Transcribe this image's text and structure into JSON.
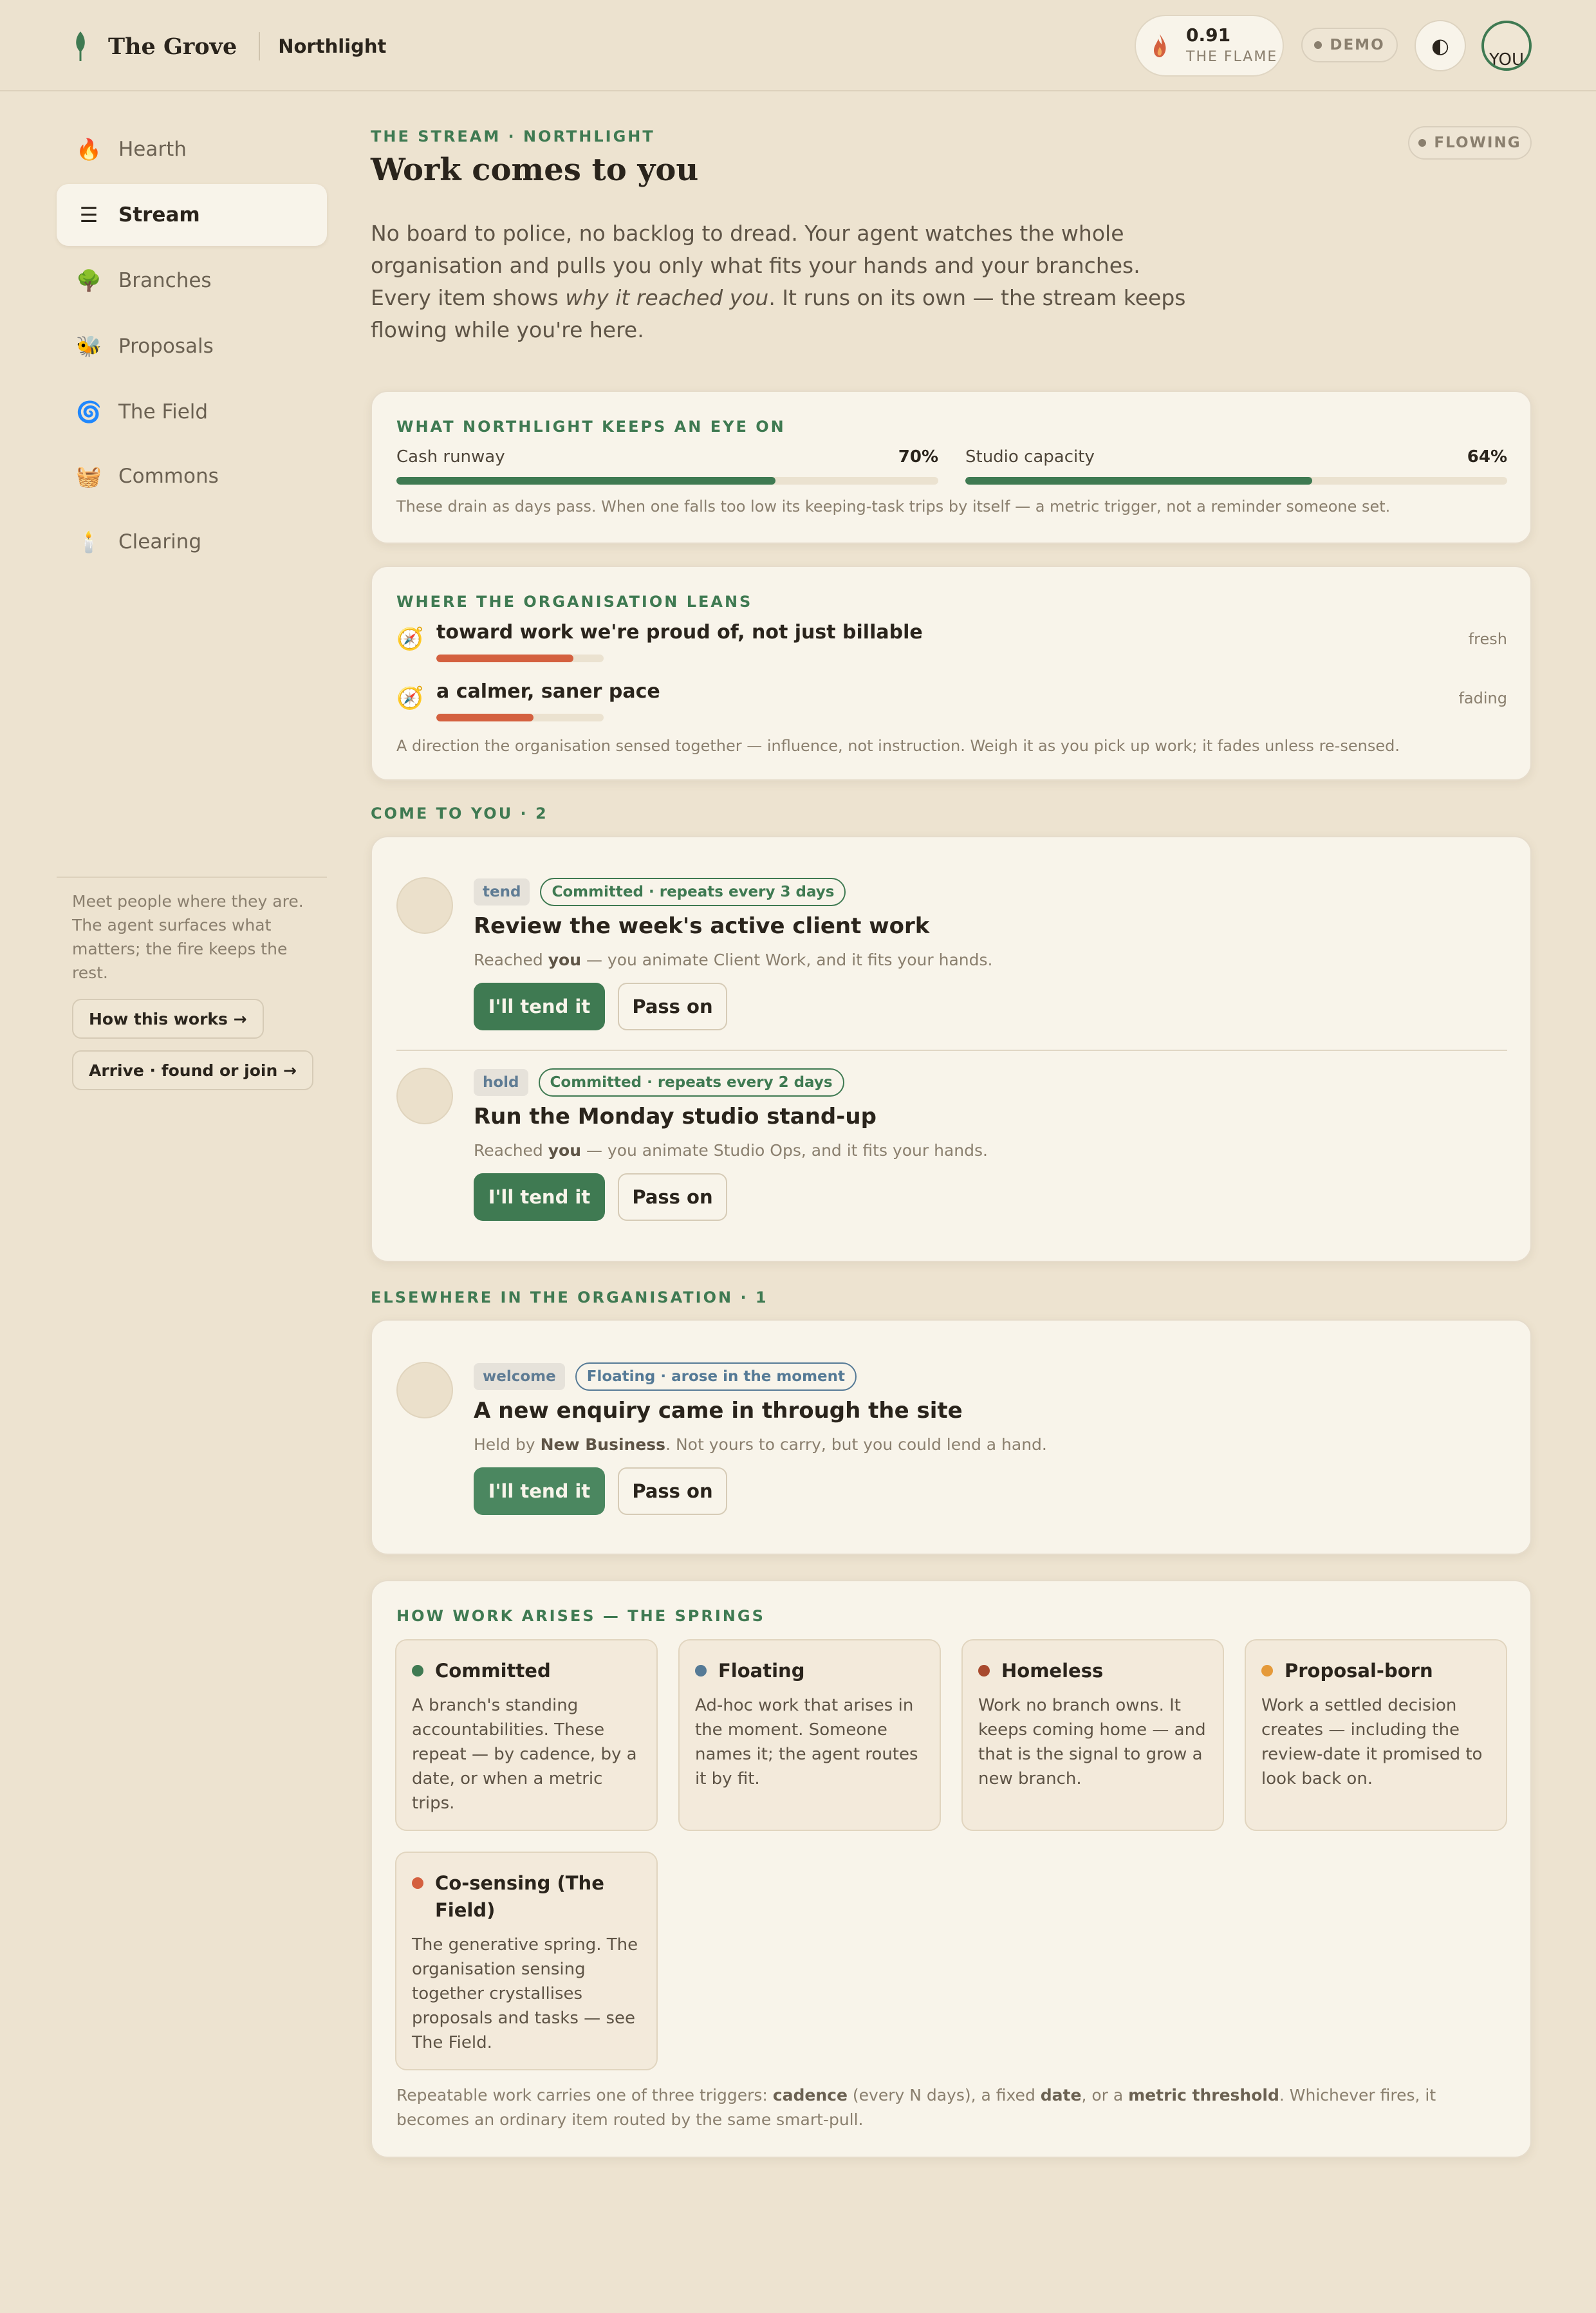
{
  "topbar": {
    "brand": "The Grove",
    "org": "Northlight",
    "flame_value": "0.91",
    "flame_label": "THE FLAME",
    "demo_label": "DEMO",
    "theme_icon": "◐",
    "avatar_alt": "YOU"
  },
  "sidebar": {
    "items": [
      {
        "icon": "🔥",
        "label": "Hearth"
      },
      {
        "icon": "☰",
        "label": "Stream"
      },
      {
        "icon": "🌳",
        "label": "Branches"
      },
      {
        "icon": "🐝",
        "label": "Proposals"
      },
      {
        "icon": "🌀",
        "label": "The Field"
      },
      {
        "icon": "🧺",
        "label": "Commons"
      },
      {
        "icon": "🕯️",
        "label": "Clearing"
      }
    ],
    "active": "Stream",
    "note": "Meet people where they are. The agent surfaces what matters; the fire keeps the rest.",
    "how_button": "How this works →",
    "arrive_button": "Arrive · found or join →"
  },
  "header": {
    "eyebrow": "THE STREAM · NORTHLIGHT",
    "title": "Work comes to you",
    "status": "FLOWING",
    "intro_a": "No board to police, no backlog to dread. Your agent watches the whole organisation and pulls you only what fits your hands and your branches. Every item shows ",
    "intro_em": "why it reached you",
    "intro_b": ". It runs on its own — the stream keeps flowing while you're here."
  },
  "watch": {
    "eyebrow": "WHAT NORTHLIGHT KEEPS AN EYE ON",
    "metrics": [
      {
        "label": "Cash runway",
        "value": "70%",
        "fraction": 0.7
      },
      {
        "label": "Studio capacity",
        "value": "64%",
        "fraction": 0.64
      }
    ],
    "foot": "These drain as days pass. When one falls too low its keeping-task trips by itself — a metric trigger, not a reminder someone set."
  },
  "leans": {
    "eyebrow": "WHERE THE ORGANISATION LEANS",
    "items": [
      {
        "icon": "🧭",
        "text": "toward work we're proud of, not just billable",
        "strength": 0.82,
        "state": "fresh"
      },
      {
        "icon": "🧭",
        "text": "a calmer, saner pace",
        "strength": 0.58,
        "state": "fading"
      }
    ],
    "foot": "A direction the organisation sensed together — influence, not instruction. Weigh it as you pick up work; it fades unless re-sensed."
  },
  "come_to_you": {
    "eyebrow": "COME TO YOU · 2",
    "items": [
      {
        "kind": "tend",
        "spring": "Committed · repeats every 3 days",
        "title": "Review the week's active client work",
        "reach_a": "Reached ",
        "reach_b": "you",
        "reach_c": " — you animate Client Work, and it fits your hands.",
        "tend": "I'll tend it",
        "pass": "Pass on"
      },
      {
        "kind": "hold",
        "spring": "Committed · repeats every 2 days",
        "title": "Run the Monday studio stand-up",
        "reach_a": "Reached ",
        "reach_b": "you",
        "reach_c": " — you animate Studio Ops, and it fits your hands.",
        "tend": "I'll tend it",
        "pass": "Pass on"
      }
    ]
  },
  "elsewhere": {
    "eyebrow": "ELSEWHERE IN THE ORGANISATION · 1",
    "items": [
      {
        "kind": "welcome",
        "spring": "Floating · arose in the moment",
        "title": "A new enquiry came in through the site",
        "reach_a": "Held by ",
        "reach_b": "New Business",
        "reach_c": ". Not yours to carry, but you could lend a hand.",
        "tend": "I'll tend it",
        "pass": "Pass on"
      }
    ]
  },
  "springs": {
    "eyebrow": "HOW WORK ARISES — THE SPRINGS",
    "items": [
      {
        "name": "Committed",
        "color": "#3f7a52",
        "body": "A branch's standing accountabilities. These repeat — by cadence, by a date, or when a metric trips."
      },
      {
        "name": "Floating",
        "color": "#557a96",
        "body": "Ad-hoc work that arises in the moment. Someone names it; the agent routes it by fit."
      },
      {
        "name": "Homeless",
        "color": "#a84a2e",
        "body": "Work no branch owns. It keeps coming home — and that is the signal to grow a new branch."
      },
      {
        "name": "Proposal-born",
        "color": "#e59a3a",
        "body": "Work a settled decision creates — including the review-date it promised to look back on."
      },
      {
        "name": "Co-sensing (The Field)",
        "color": "#d4603f",
        "body": "The generative spring. The organisation sensing together crystallises proposals and tasks — see The Field."
      }
    ],
    "foot_1": "Repeatable work carries one of three triggers: ",
    "foot_cadence": "cadence",
    "foot_2": " (every N days), a fixed ",
    "foot_date": "date",
    "foot_3": ", or a ",
    "foot_metric": "metric threshold",
    "foot_4": ". Whichever fires, it becomes an ordinary item routed by the same smart-pull."
  }
}
